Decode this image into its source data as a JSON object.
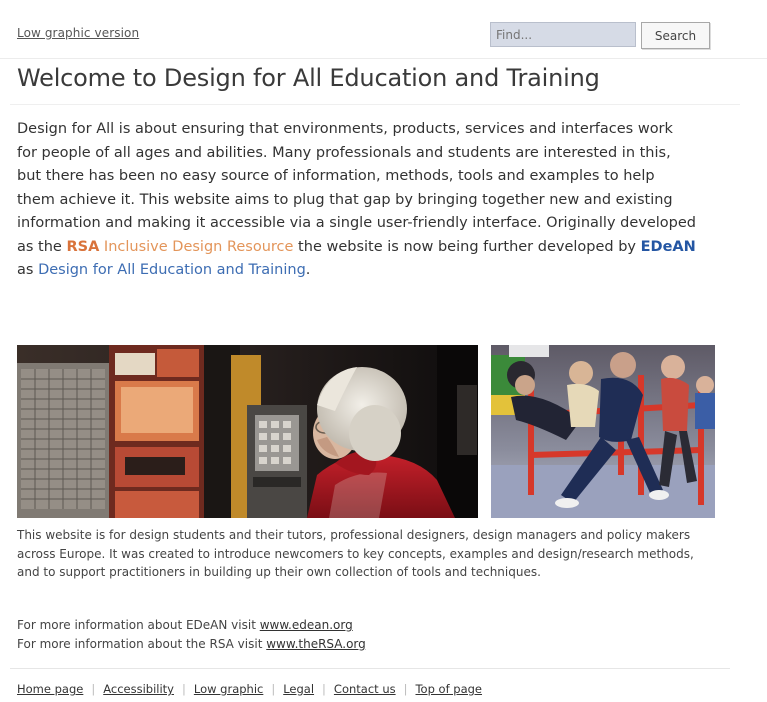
{
  "header": {
    "low_graphic_link": "Low graphic version",
    "search_placeholder": "Find...",
    "search_button": "Search"
  },
  "main": {
    "title": "Welcome to Design for All Education and Training",
    "intro_parts": {
      "p1": "Design for All is about ensuring that environments, products, services and interfaces work for people of all ages and abilities. Many professionals and students are interested in this, but there has been no easy source of information, methods, tools and examples to help them achieve it. This website aims to plug that gap by bringing together new and existing information and making it accessible via a single user-friendly interface. Originally developed as the ",
      "rsa": "RSA",
      "rsa_link": "Inclusive Design Resource",
      "p2": " the website is now being further developed by ",
      "edean": "EDeAN",
      "p3": " as ",
      "dfa_link": "Design for All Education and Training",
      "p4": "."
    },
    "description": "This website is for design students and their tutors, professional designers, design managers and policy makers across Europe. It was created to introduce newcomers to key concepts, examples and design/research methods, and to support practitioners in building up their own collection of tools and techniques.",
    "edean_info_text": "For more information about EDeAN visit ",
    "edean_url": "www.edean.org",
    "rsa_info_text": "For more information about the RSA visit ",
    "rsa_url": "www.theRSA.org"
  },
  "footer": {
    "links": [
      "Home page",
      "Accessibility",
      "Low graphic",
      "Legal",
      "Contact us",
      "Top of page"
    ]
  },
  "colors": {
    "rsa_orange": "#d9733b",
    "edean_blue": "#2456a3",
    "search_field_bg": "#d6dbe6"
  }
}
